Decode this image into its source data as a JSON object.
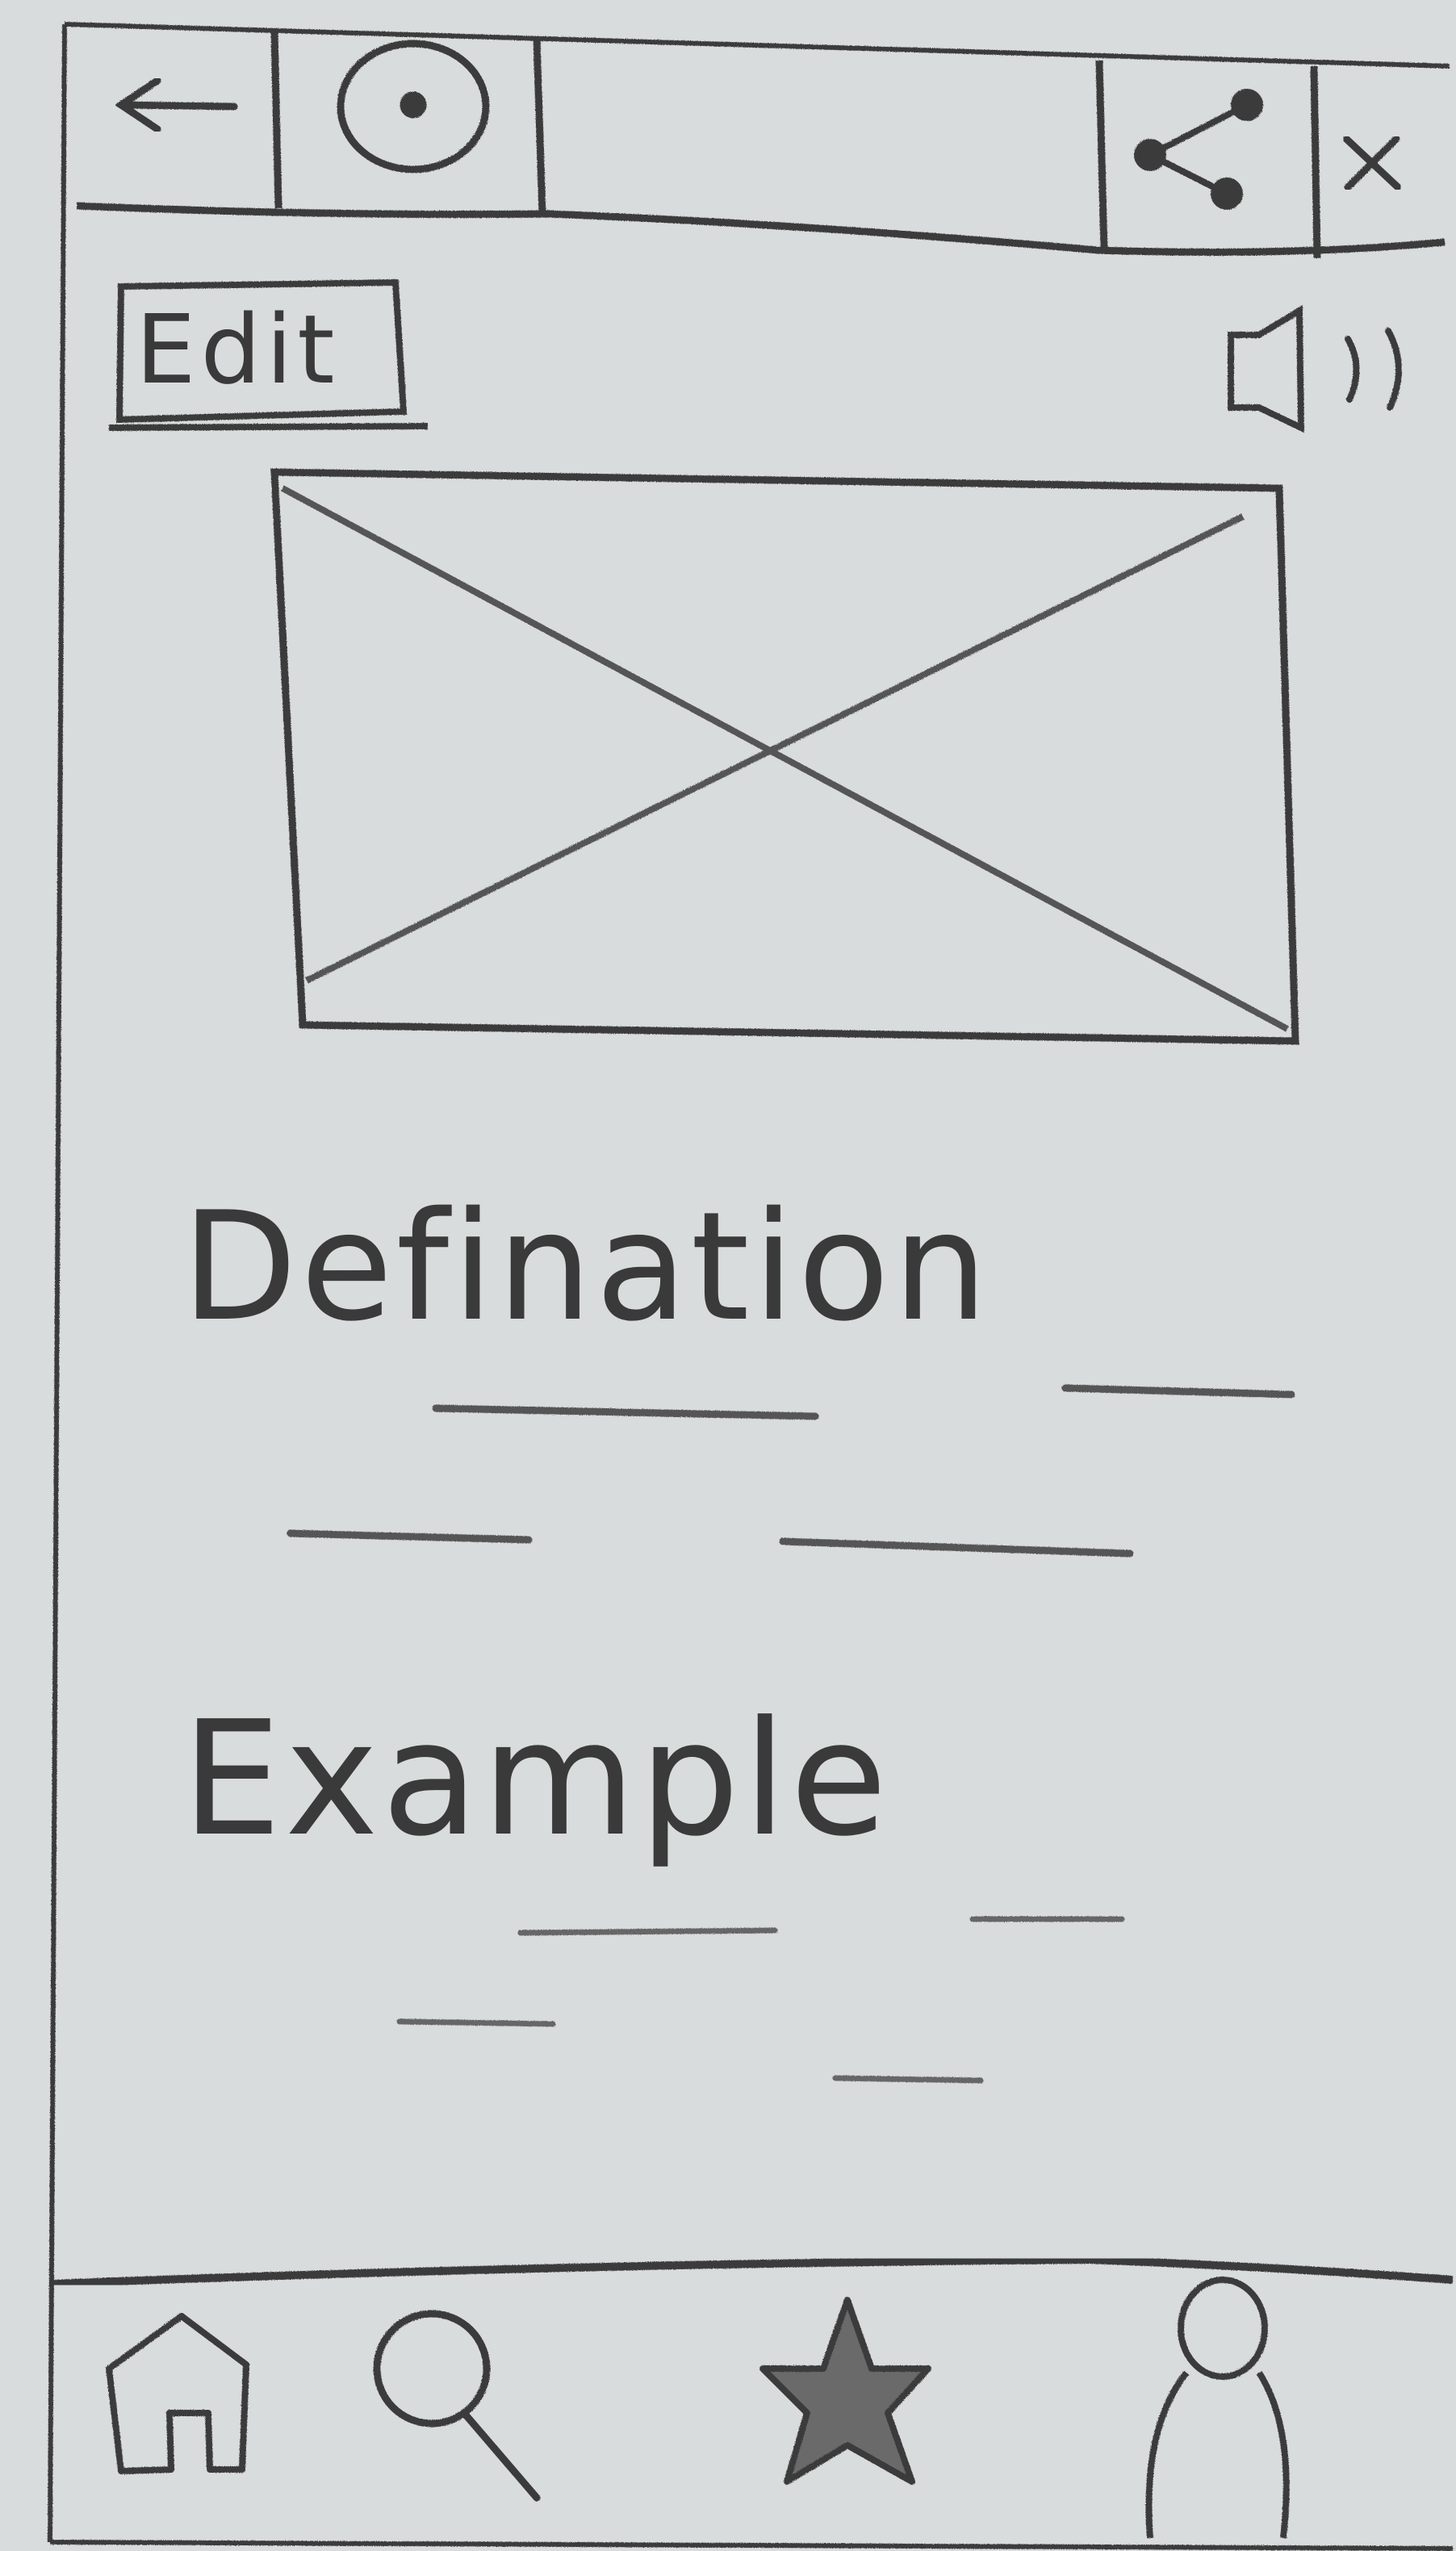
{
  "toolbar": {
    "back_icon": "back-arrow-icon",
    "target_icon": "target-icon",
    "share_icon": "share-icon",
    "close_icon": "close-icon",
    "close_label": "x"
  },
  "action_bar": {
    "edit_label": "Edit",
    "speaker_icon": "speaker-icon"
  },
  "content": {
    "image_placeholder_icon": "image-placeholder-icon",
    "definition_heading": "Defination",
    "example_heading": "Example"
  },
  "bottom_nav": {
    "items": [
      {
        "icon": "home-icon"
      },
      {
        "icon": "search-icon"
      },
      {
        "icon": "star-icon"
      },
      {
        "icon": "profile-icon"
      }
    ]
  },
  "colors": {
    "paper": "#d9dcdc",
    "pencil": "#3a3a3a",
    "pencil_light": "#6b6b6b"
  }
}
